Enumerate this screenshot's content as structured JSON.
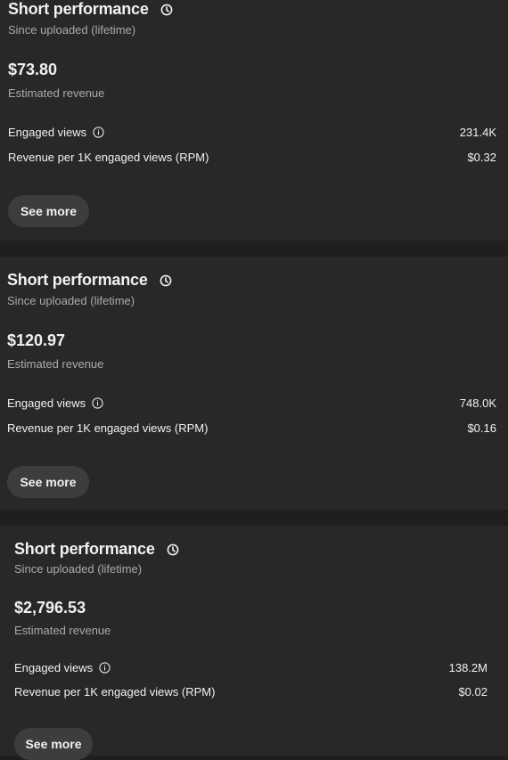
{
  "cards": [
    {
      "title": "Short performance",
      "subtitle": "Since uploaded (lifetime)",
      "revenue": "$73.80",
      "revenue_label": "Estimated revenue",
      "metrics": [
        {
          "label": "Engaged views",
          "value": "231.4K",
          "info_icon": "info-icon"
        },
        {
          "label": "Revenue per 1K engaged views (RPM)",
          "value": "$0.32"
        }
      ],
      "see_more_label": "See more",
      "title_icon": "clock-icon"
    },
    {
      "title": "Short performance",
      "subtitle": "Since uploaded (lifetime)",
      "revenue": "$120.97",
      "revenue_label": "Estimated revenue",
      "metrics": [
        {
          "label": "Engaged views",
          "value": "748.0K",
          "info_icon": "info-icon"
        },
        {
          "label": "Revenue per 1K engaged views (RPM)",
          "value": "$0.16"
        }
      ],
      "see_more_label": "See more",
      "title_icon": "clock-icon"
    },
    {
      "title": "Short performance",
      "subtitle": "Since uploaded (lifetime)",
      "revenue": "$2,796.53",
      "revenue_label": "Estimated revenue",
      "metrics": [
        {
          "label": "Engaged views",
          "value": "138.2M",
          "info_icon": "info-icon"
        },
        {
          "label": "Revenue per 1K engaged views (RPM)",
          "value": "$0.02"
        }
      ],
      "see_more_label": "See more",
      "title_icon": "clock-icon"
    }
  ],
  "colors": {
    "page_background": "#1f1f1f",
    "card_background": "#282828",
    "primary_text": "#f1f1f1",
    "secondary_text": "#aaaaaa",
    "button_background": "#3d3d3d"
  }
}
